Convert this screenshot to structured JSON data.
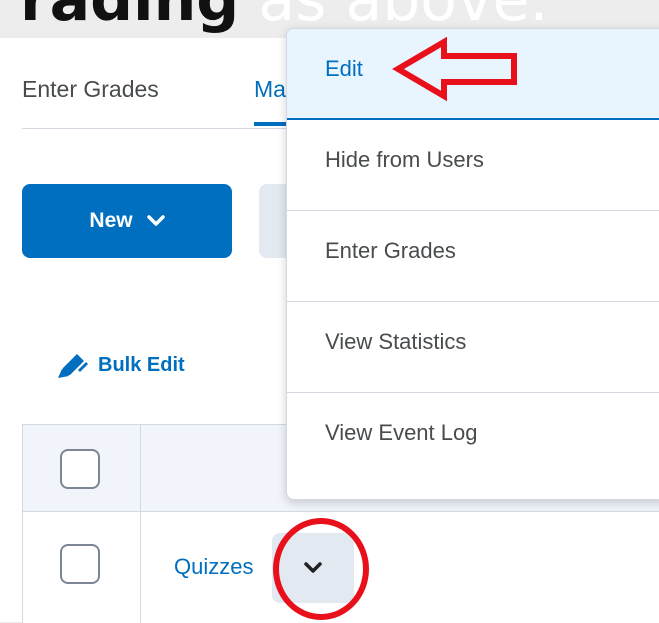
{
  "headline": {
    "bold": "rading",
    "light": "as above."
  },
  "tabs": [
    {
      "label": "Enter Grades"
    },
    {
      "label": "Ma"
    }
  ],
  "toolbar": {
    "new_label": "New",
    "bulk_edit_label": "Bulk Edit"
  },
  "table": {
    "row_item_label": "Quizzes"
  },
  "context_menu": {
    "items": [
      {
        "label": "Edit"
      },
      {
        "label": "Hide from Users"
      },
      {
        "label": "Enter Grades"
      },
      {
        "label": "View Statistics"
      },
      {
        "label": "View Event Log"
      }
    ]
  },
  "colors": {
    "accent": "#006fbf",
    "annotation_red": "#e8101a",
    "menu_active_bg": "#e9f5fe"
  },
  "icons": [
    "chevron-down-icon",
    "pencil-icon",
    "arrow-annotation",
    "circle-annotation"
  ]
}
